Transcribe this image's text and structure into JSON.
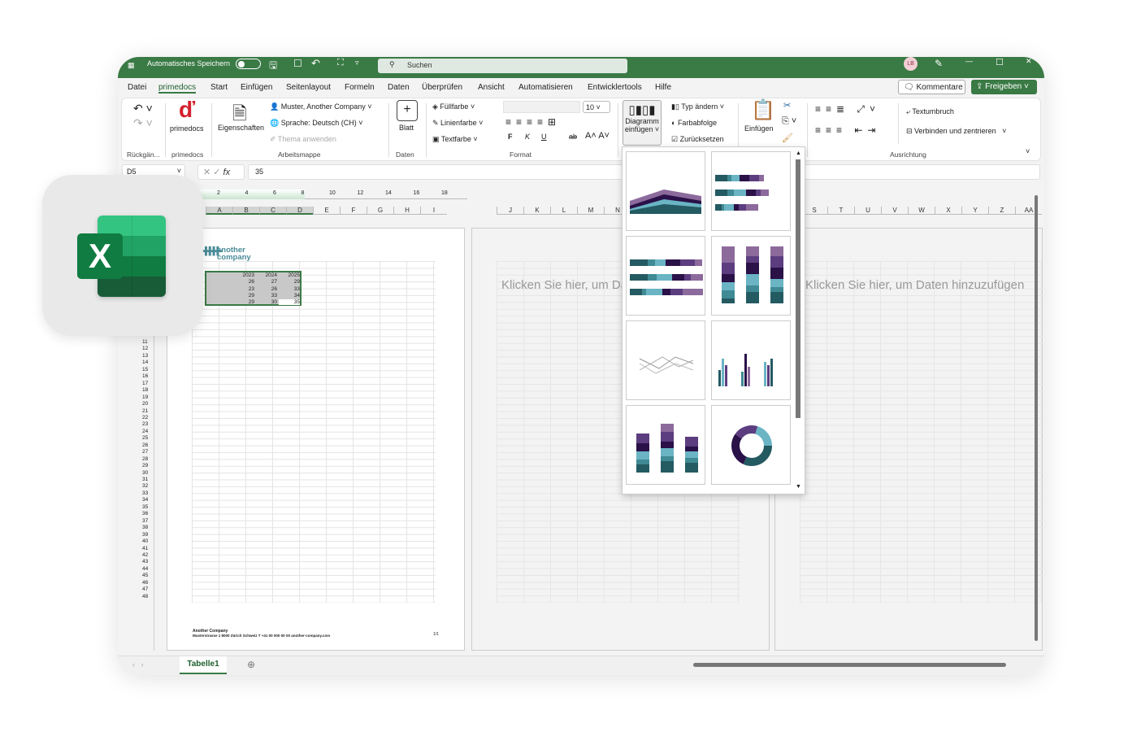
{
  "titlebar": {
    "autosave_label": "Automatisches Speichern",
    "search_placeholder": "Suchen",
    "user_initials": "LB"
  },
  "menu": [
    "Datei",
    "primedocs",
    "Start",
    "Einfügen",
    "Seitenlayout",
    "Formeln",
    "Daten",
    "Überprüfen",
    "Ansicht",
    "Automatisieren",
    "Entwicklertools",
    "Hilfe"
  ],
  "active_menu": "primedocs",
  "actions": {
    "comments": "Kommentare",
    "share": "Freigeben"
  },
  "ribbon": {
    "undo_group": "Rückgän...",
    "primedocs_btn": "primedocs",
    "primedocs_group": "primedocs",
    "properties": "Eigenschaften",
    "contact": "Muster, Another Company",
    "language": "Sprache: Deutsch (CH)",
    "theme": "Thema anwenden",
    "workbook_group": "Arbeitsmappe",
    "sheet": "Blatt",
    "data_group": "Daten",
    "fill": "Füllfarbe",
    "line": "Linienfarbe",
    "textcolor": "Textfarbe",
    "font_size": "10",
    "bold": "F",
    "italic": "K",
    "underline": "U",
    "format_group": "Format",
    "chart_line1": "Diagramm",
    "chart_line2": "einfügen",
    "change_type": "Typ ändern",
    "color_seq": "Farbabfolge",
    "reset": "Zurücksetzen",
    "paste": "Einfügen",
    "wrap": "Textumbruch",
    "merge": "Verbinden und zentrieren",
    "align_group": "Ausrichtung"
  },
  "formula": {
    "cell_ref": "D5",
    "value": "35"
  },
  "ruler": [
    "2",
    "4",
    "6",
    "8",
    "10",
    "12",
    "14",
    "16",
    "18"
  ],
  "columns_page1": [
    "A",
    "B",
    "C",
    "D",
    "E",
    "F",
    "G",
    "H",
    "I"
  ],
  "columns_page2": [
    "J",
    "K",
    "L",
    "M",
    "N"
  ],
  "columns_page3": [
    "S",
    "T",
    "U",
    "V",
    "W",
    "X",
    "Y",
    "Z",
    "AA"
  ],
  "row_numbers": [
    11,
    12,
    13,
    14,
    15,
    16,
    17,
    18,
    19,
    20,
    21,
    22,
    23,
    24,
    25,
    26,
    27,
    28,
    29,
    30,
    31,
    32,
    33,
    34,
    35,
    36,
    37,
    38,
    39,
    40,
    41,
    42,
    43,
    44,
    45,
    46,
    47,
    48
  ],
  "logo": {
    "line1": "another",
    "line2": "company"
  },
  "table": {
    "headers": [
      "2023",
      "2024",
      "2025"
    ],
    "rows": [
      [
        "26",
        "27",
        "29"
      ],
      [
        "23",
        "26",
        "33"
      ],
      [
        "29",
        "33",
        "34"
      ],
      [
        "29",
        "30",
        "35"
      ]
    ]
  },
  "footer": {
    "company": "Another Company",
    "address": "Musterstrasse 1 8000 Zürich Schweiz T +41 00 000 00 00 another-company.com",
    "page": "1/1"
  },
  "placeholder": "Klicken Sie hier, um Daten hinzuzufügen",
  "sheet_tabs": [
    "Tabelle1"
  ],
  "colors": {
    "accent": "#3a7a45",
    "palette": [
      "#245a62",
      "#3f8a94",
      "#6ab4c4",
      "#2a1148",
      "#5c3d80",
      "#8c6a9c"
    ]
  },
  "gallery_icons": [
    "stacked-area-chart-icon",
    "stacked-bar-chart-icon",
    "stacked-bar-100-chart-icon",
    "stacked-column-chart-icon",
    "line-chart-icon",
    "clustered-column-chart-icon",
    "stacked-column-small-icon",
    "donut-chart-icon"
  ]
}
